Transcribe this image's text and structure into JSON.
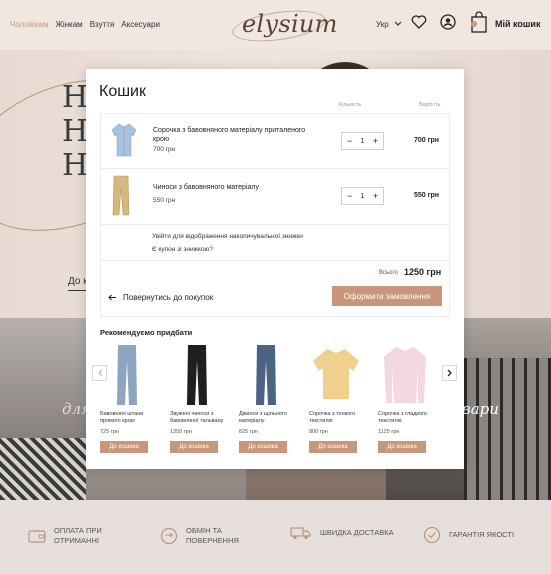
{
  "header": {
    "nav": [
      "Чоловікам",
      "Жінкам",
      "Взуття",
      "Аксесуари"
    ],
    "logo": "elysium",
    "lang": "Укр",
    "cart_label": "Мій кошик",
    "colors": {
      "accent": "#c79a83"
    }
  },
  "hero": {
    "letters": [
      "Н",
      "Н",
      "Н"
    ],
    "link": "До ка"
  },
  "gallery": {
    "left_text": "для",
    "right_text": "вари"
  },
  "features": [
    {
      "icon": "wallet-icon",
      "label": "ОПЛАТА ПРИ ОТРИМАННІ"
    },
    {
      "icon": "exchange-icon",
      "label": "ОБМІН ТА ПОВЕРНЕННЯ"
    },
    {
      "icon": "truck-icon",
      "label": "ШВИДКА ДОСТАВКА"
    },
    {
      "icon": "quality-badge-icon",
      "label": "ГАРАНТІЯ ЯКОСТІ"
    }
  ],
  "cart": {
    "title": "Кошик",
    "col_qty": "Кількість",
    "col_value": "Вартість",
    "items": [
      {
        "name": "Сорочка з бавовняного матеріалу приталеного крою",
        "price": "700 грн",
        "qty": "1",
        "total": "700 грн"
      },
      {
        "name": "Чиноси з бавовняного матеріалу",
        "price": "550 грн",
        "qty": "1",
        "total": "550 грн"
      }
    ],
    "promo_line": "Увійти для відображення накопичувальної знижки",
    "coupon_line": "Є купон зі знижкою?",
    "sum_label": "Всього",
    "sum_value": "1250 грн",
    "back": "Повернутись до покупок",
    "checkout": "Оформити замовлення"
  },
  "recommended": {
    "title": "Рекомендуємо придбати",
    "button": "До кошика",
    "items": [
      {
        "name": "Бавовняні штани прямого крою",
        "price": "725 грн"
      },
      {
        "name": "Звужені чиноси з бавовняної тальвану",
        "price": "1350 грн"
      },
      {
        "name": "Джинси з щільного матеріалу",
        "price": "825 грн"
      },
      {
        "name": "Сорочка з тонкого текстилю",
        "price": "800 грн"
      },
      {
        "name": "Сорочка з гладкого текстилю",
        "price": "1125 грн"
      }
    ]
  }
}
